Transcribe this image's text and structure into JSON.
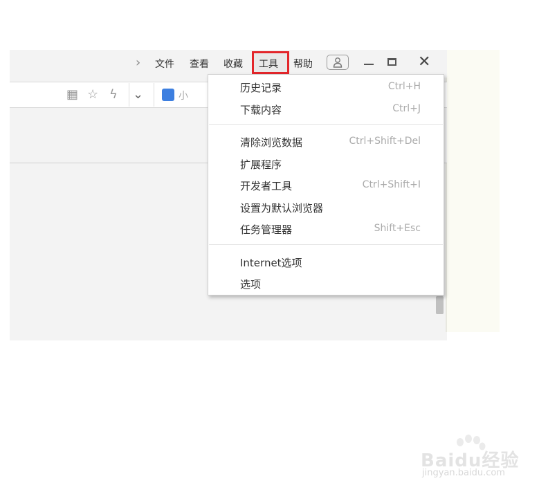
{
  "menubar": {
    "items": [
      "文件",
      "查看",
      "收藏",
      "工具",
      "帮助"
    ]
  },
  "address_bar": {
    "search_hint": "小"
  },
  "tools_menu": {
    "items": [
      {
        "label": "历史记录",
        "shortcut": "Ctrl+H"
      },
      {
        "label": "下载内容",
        "shortcut": "Ctrl+J"
      },
      {
        "label": "清除浏览数据",
        "shortcut": "Ctrl+Shift+Del"
      },
      {
        "label": "扩展程序",
        "shortcut": ""
      },
      {
        "label": "开发者工具",
        "shortcut": "Ctrl+Shift+I"
      },
      {
        "label": "设置为默认浏览器",
        "shortcut": ""
      },
      {
        "label": "任务管理器",
        "shortcut": "Shift+Esc"
      },
      {
        "label": "Internet选项",
        "shortcut": ""
      },
      {
        "label": "选项",
        "shortcut": ""
      }
    ]
  },
  "watermark": {
    "brand": "Baidu经验",
    "url": "jingyan.baidu.com"
  },
  "colors": {
    "highlight_border": "#e3262b",
    "search_icon": "#3d7fe0"
  }
}
